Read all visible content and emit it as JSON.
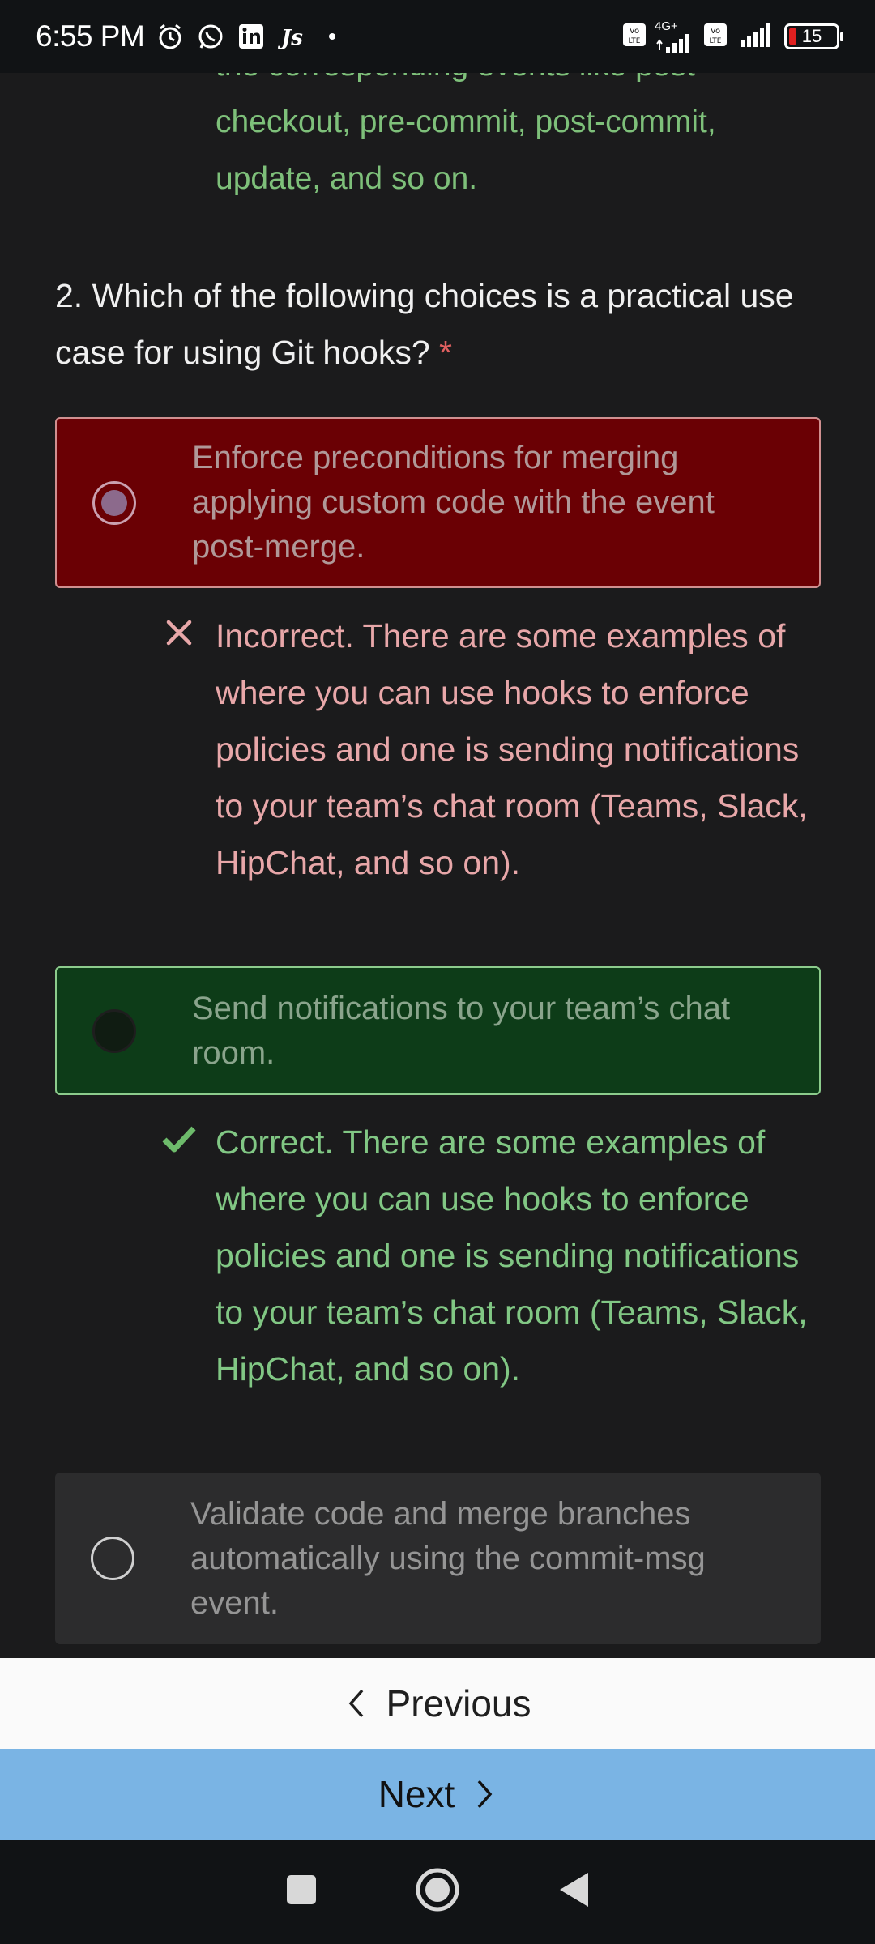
{
  "status_bar": {
    "time": "6:55 PM",
    "battery_percent": "15",
    "network": "4G+",
    "left_icons": [
      "alarm-icon",
      "whatsapp-icon",
      "linkedin-icon",
      "js-icon"
    ],
    "right_icons": [
      "volte-icon",
      "signal-icon",
      "volte-icon",
      "signal-icon",
      "battery-icon"
    ]
  },
  "previous_feedback": "the corresponding events like post-checkout, pre-commit, post-commit, update, and so on.",
  "question": {
    "text": "2. Which of the following choices is a practical use case for using Git hooks?",
    "required_marker": "*"
  },
  "options": [
    {
      "text": "Enforce preconditions for merging applying custom code with the event post-merge.",
      "state": "selected-incorrect"
    },
    {
      "text": "Send notifications to your team’s chat room.",
      "state": "correct-answer"
    },
    {
      "text": "Validate code and merge branches automatically using the commit-msg event.",
      "state": "unselected"
    }
  ],
  "feedback": {
    "incorrect": "Incorrect. There are some examples of where you can use hooks to enforce policies and one is sending notifications to your team’s chat room (Teams, Slack, HipChat, and so on).",
    "correct": "Correct. There are some examples of where you can use hooks to enforce policies and one is sending notifications to your team’s chat room (Teams, Slack, HipChat, and so on)."
  },
  "navigation": {
    "previous_label": "Previous",
    "next_label": "Next"
  },
  "colors": {
    "incorrect_bg": "#6a0004",
    "correct_bg": "#0d3c18",
    "incorrect_text": "#e8a7a9",
    "correct_text": "#81c784",
    "next_button_bg": "#7ab4e4"
  }
}
